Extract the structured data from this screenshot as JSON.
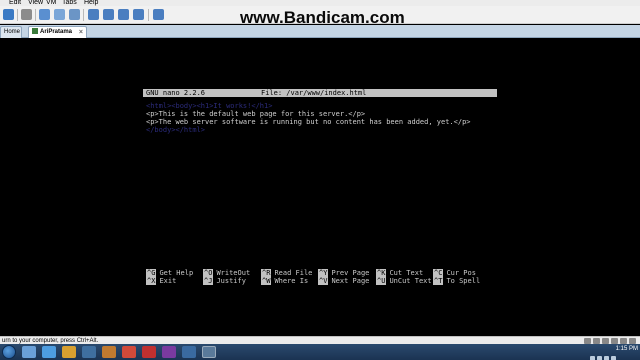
{
  "menubar": {
    "items": [
      "Edit",
      "View",
      "VM",
      "Tabs",
      "Help"
    ]
  },
  "watermark": "www.Bandicam.com",
  "tabs": [
    {
      "label": "Home"
    },
    {
      "label": "AriPratama"
    }
  ],
  "nano": {
    "version": "GNU nano 2.2.6",
    "file": "File: /var/www/index.html"
  },
  "content": {
    "line1": "<html><body><h1>It works!</h1>",
    "line2": "<p>This is the default web page for this server.</p>",
    "line3": "<p>The web server software is running but no content has been added, yet.</p>",
    "line4": "</body></html>"
  },
  "shortcuts": [
    {
      "key": "^G",
      "label": "Get Help"
    },
    {
      "key": "^O",
      "label": "WriteOut"
    },
    {
      "key": "^R",
      "label": "Read File"
    },
    {
      "key": "^Y",
      "label": "Prev Page"
    },
    {
      "key": "^K",
      "label": "Cut Text"
    },
    {
      "key": "^C",
      "label": "Cur Pos"
    },
    {
      "key": "^X",
      "label": "Exit"
    },
    {
      "key": "^J",
      "label": "Justify"
    },
    {
      "key": "^W",
      "label": "Where Is"
    },
    {
      "key": "^V",
      "label": "Next Page"
    },
    {
      "key": "^U",
      "label": "UnCut Text"
    },
    {
      "key": "^T",
      "label": "To Spell"
    }
  ],
  "status_hint": "urn to your computer, press Ctrl+Alt.",
  "clock": {
    "time": "1:15 PM"
  },
  "colors": {
    "term_bg": "#000000",
    "nano_bar": "#c2c2c2",
    "tab_strip": "#c5d5e5"
  }
}
